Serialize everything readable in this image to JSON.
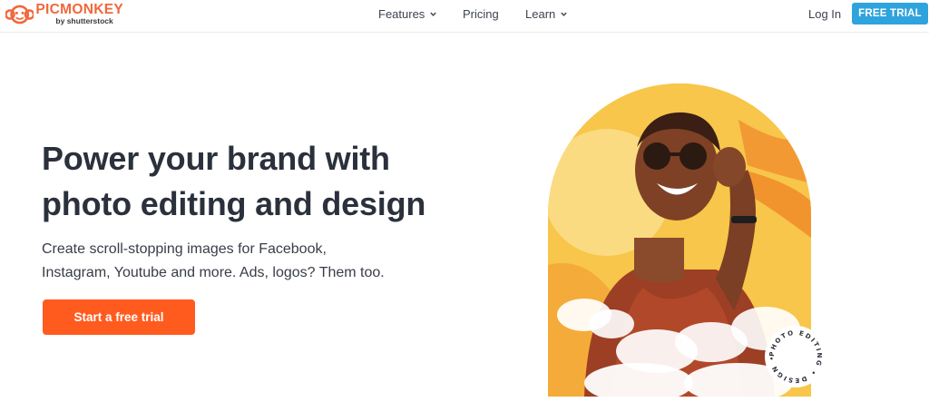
{
  "brand": {
    "name": "PICMONKEY",
    "sub": "by shutterstock",
    "color": "#f0683a",
    "logo_icon": "monkey-face-icon"
  },
  "nav": {
    "features": "Features",
    "pricing": "Pricing",
    "learn": "Learn",
    "login": "Log In",
    "trial": "FREE TRIAL",
    "dropdown_icon": "chevron-down-icon"
  },
  "hero": {
    "title_line1": "Power your brand with",
    "title_line2": "photo editing and design",
    "sub_line1": "Create scroll-stopping images for Facebook,",
    "sub_line2": "Instagram, Youtube and more. Ads, logos? Them too.",
    "cta": "Start a free trial",
    "badge_text": "PHOTO EDITING • DESIGN •"
  },
  "colors": {
    "trial_button": "#2fa3dd",
    "cta_button": "#ff5b1f",
    "image_background": "#f6c444"
  }
}
